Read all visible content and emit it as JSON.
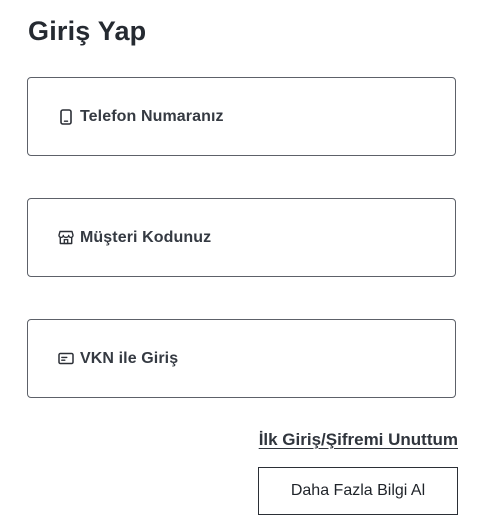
{
  "page": {
    "title": "Giriş Yap"
  },
  "login_options": [
    {
      "label": "Telefon Numaranız",
      "icon": "phone-icon"
    },
    {
      "label": "Müşteri Kodunuz",
      "icon": "store-icon"
    },
    {
      "label": "VKN ile Giriş",
      "icon": "id-card-icon"
    }
  ],
  "links": {
    "forgot_password": "İlk Giriş/Şifremi Unuttum"
  },
  "buttons": {
    "more_info": "Daha Fazla Bilgi Al"
  },
  "colors": {
    "text": "#2b2f36",
    "border": "#5d6169",
    "background": "#ffffff"
  }
}
